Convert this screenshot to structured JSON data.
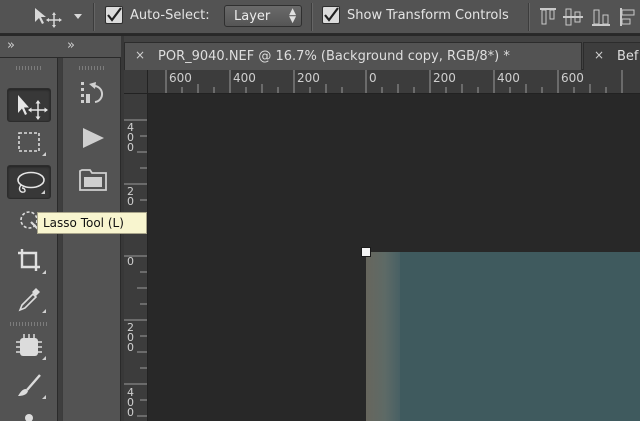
{
  "options_bar": {
    "auto_select_label": "Auto-Select:",
    "auto_select_checked": true,
    "layer_select_value": "Layer",
    "show_transform_label": "Show Transform Controls",
    "show_transform_checked": true
  },
  "tabs": [
    {
      "close": "×",
      "title": "POR_9040.NEF @ 16.7% (Background copy, RGB/8*) *"
    },
    {
      "close": "×",
      "title": "Bef"
    }
  ],
  "panel_collapse_glyphs": [
    "»",
    "»"
  ],
  "tools": [
    {
      "icon": "move-icon",
      "selected": true
    },
    {
      "icon": "rectangular-marquee-icon"
    },
    {
      "icon": "lasso-icon"
    },
    {
      "icon": "quick-selection-icon"
    },
    {
      "icon": "crop-icon"
    },
    {
      "icon": "eyedropper-icon"
    },
    {
      "icon": "spot-healing-icon"
    },
    {
      "icon": "brush-icon"
    }
  ],
  "actions": [
    {
      "icon": "history-icon"
    },
    {
      "icon": "play-icon"
    },
    {
      "icon": "folder-icon"
    }
  ],
  "tooltip": "Lasso Tool (L)",
  "ruler": {
    "horizontal_labels": [
      "600",
      "400",
      "200",
      "0",
      "200",
      "400",
      "600"
    ],
    "vertical_labels": [
      [
        "4",
        "0",
        "0"
      ],
      [
        "2",
        "0"
      ],
      [
        "0"
      ],
      [
        "2",
        "0",
        "0"
      ],
      [
        "4",
        "0",
        "0"
      ]
    ]
  },
  "colors": {
    "panel": "#535353",
    "pasteboard": "#282828",
    "image_teal": "#3f5a5e",
    "tooltip_bg": "#f8f5cf"
  }
}
